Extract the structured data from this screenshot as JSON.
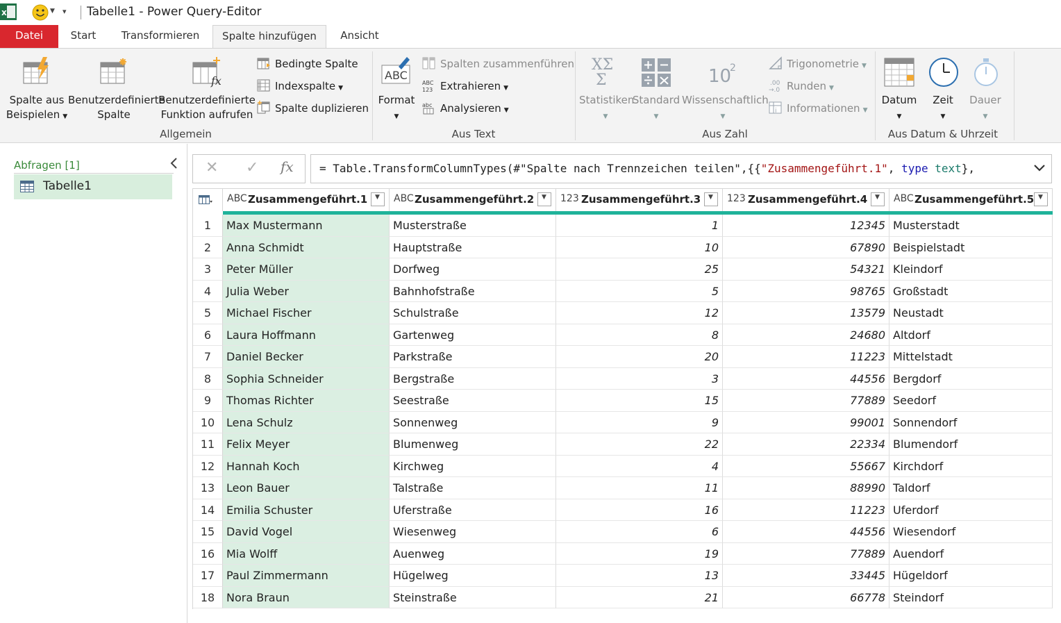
{
  "window": {
    "title": "Tabelle1 - Power Query-Editor"
  },
  "tabs": [
    {
      "label": "Datei"
    },
    {
      "label": "Start"
    },
    {
      "label": "Transformieren"
    },
    {
      "label": "Spalte hinzufügen"
    },
    {
      "label": "Ansicht"
    }
  ],
  "ribbon": {
    "allgemein": {
      "label": "Allgemein",
      "spalte_aus_beispielen": {
        "line1": "Spalte aus",
        "line2": "Beispielen"
      },
      "benutzerdef_spalte": {
        "line1": "Benutzerdefinierte",
        "line2": "Spalte"
      },
      "benutzerdef_funktion": {
        "line1": "Benutzerdefinierte",
        "line2": "Funktion aufrufen"
      },
      "bedingte_spalte": "Bedingte Spalte",
      "indexspalte": "Indexspalte",
      "spalte_duplizieren": "Spalte duplizieren"
    },
    "aus_text": {
      "label": "Aus Text",
      "format": "Format",
      "spalten_zusammenfuehren": "Spalten zusammenführen",
      "extrahieren": "Extrahieren",
      "analysieren": "Analysieren"
    },
    "aus_zahl": {
      "label": "Aus Zahl",
      "statistiken": "Statistiken",
      "standard": "Standard",
      "wissenschaftlich": "Wissenschaftlich",
      "trigonometrie": "Trigonometrie",
      "runden": "Runden",
      "informationen": "Informationen"
    },
    "aus_datum": {
      "label": "Aus Datum & Uhrzeit",
      "datum": "Datum",
      "zeit": "Zeit",
      "dauer": "Dauer"
    }
  },
  "queries": {
    "header": "Abfragen [1]",
    "items": [
      {
        "label": "Tabelle1"
      }
    ]
  },
  "formula": {
    "prefix": "= Table.TransformColumnTypes(#\"Spalte nach Trennzeichen teilen\",{{",
    "string": "\"Zusammengeführt.1\"",
    "sep": ", ",
    "keyword": "type",
    "space": " ",
    "type": "text",
    "suffix": "},"
  },
  "table": {
    "columns": [
      {
        "type_icon": "ABC",
        "name": "Zusammengeführt.1"
      },
      {
        "type_icon": "ABC",
        "name": "Zusammengeführt.2"
      },
      {
        "type_icon": "123",
        "name": "Zusammengeführt.3"
      },
      {
        "type_icon": "123",
        "name": "Zusammengeführt.4"
      },
      {
        "type_icon": "ABC",
        "name": "Zusammengeführt.5"
      }
    ],
    "rows": [
      [
        "1",
        "Max Mustermann",
        "Musterstraße",
        "1",
        "12345",
        "Musterstadt"
      ],
      [
        "2",
        "Anna Schmidt",
        "Hauptstraße",
        "10",
        "67890",
        "Beispielstadt"
      ],
      [
        "3",
        "Peter Müller",
        "Dorfweg",
        "25",
        "54321",
        "Kleindorf"
      ],
      [
        "4",
        "Julia Weber",
        "Bahnhofstraße",
        "5",
        "98765",
        "Großstadt"
      ],
      [
        "5",
        "Michael Fischer",
        "Schulstraße",
        "12",
        "13579",
        "Neustadt"
      ],
      [
        "6",
        "Laura Hoffmann",
        "Gartenweg",
        "8",
        "24680",
        "Altdorf"
      ],
      [
        "7",
        "Daniel Becker",
        "Parkstraße",
        "20",
        "11223",
        "Mittelstadt"
      ],
      [
        "8",
        "Sophia Schneider",
        "Bergstraße",
        "3",
        "44556",
        "Bergdorf"
      ],
      [
        "9",
        "Thomas Richter",
        "Seestraße",
        "15",
        "77889",
        "Seedorf"
      ],
      [
        "10",
        "Lena Schulz",
        "Sonnenweg",
        "9",
        "99001",
        "Sonnendorf"
      ],
      [
        "11",
        "Felix Meyer",
        "Blumenweg",
        "22",
        "22334",
        "Blumendorf"
      ],
      [
        "12",
        "Hannah Koch",
        "Kirchweg",
        "4",
        "55667",
        "Kirchdorf"
      ],
      [
        "13",
        "Leon Bauer",
        "Talstraße",
        "11",
        "88990",
        "Taldorf"
      ],
      [
        "14",
        "Emilia Schuster",
        "Uferstraße",
        "16",
        "11223",
        "Uferdorf"
      ],
      [
        "15",
        "David Vogel",
        "Wiesenweg",
        "6",
        "44556",
        "Wiesendorf"
      ],
      [
        "16",
        "Mia Wolff",
        "Auenweg",
        "19",
        "77889",
        "Auendorf"
      ],
      [
        "17",
        "Paul Zimmermann",
        "Hügelweg",
        "13",
        "33445",
        "Hügeldorf"
      ],
      [
        "18",
        "Nora Braun",
        "Steinstraße",
        "21",
        "66778",
        "Steindorf"
      ]
    ]
  },
  "colors": {
    "file_tab": "#d9272e",
    "accent_teal": "#1fb39a",
    "selected_column": "#dbefe2",
    "query_selected": "#d8eedd"
  }
}
